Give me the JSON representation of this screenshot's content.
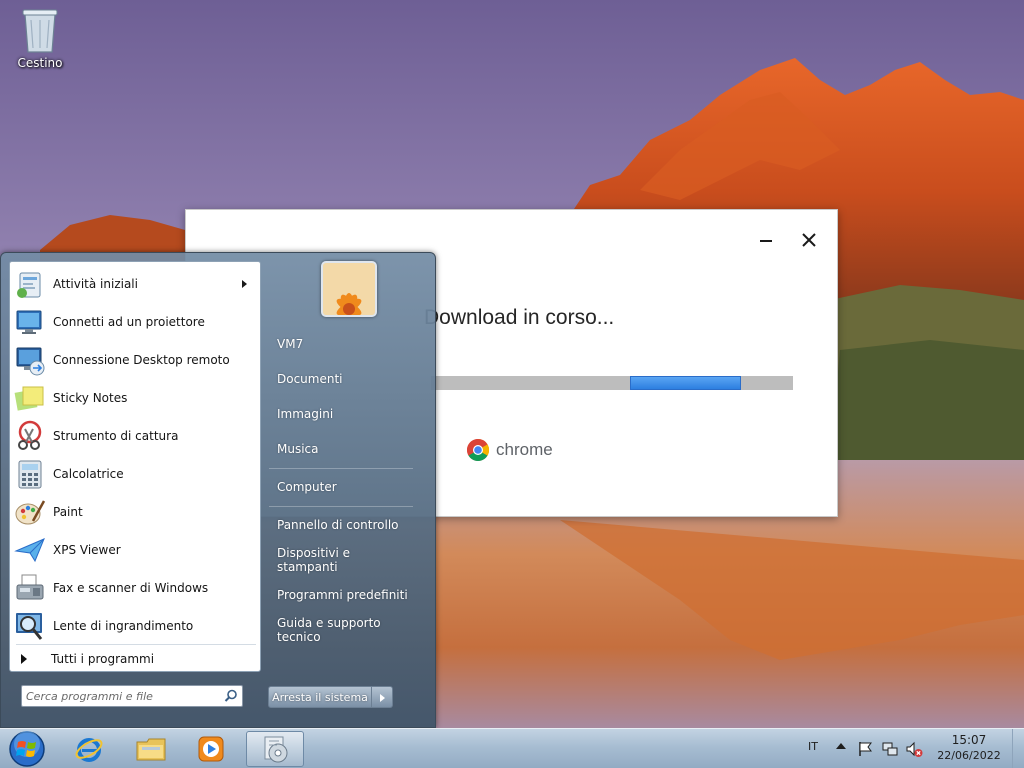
{
  "desktop": {
    "icons": [
      {
        "label": "Cestino",
        "icon": "recycle-bin-icon"
      }
    ]
  },
  "installer": {
    "title": "Download in corso...",
    "progress": 0.31,
    "brand": "chrome",
    "minimize_icon": "minimize-icon",
    "close_icon": "close-icon"
  },
  "start_menu": {
    "programs": [
      {
        "label": "Attività iniziali",
        "icon": "getting-started-icon",
        "has_submenu": true
      },
      {
        "label": "Connetti ad un proiettore",
        "icon": "projector-icon"
      },
      {
        "label": "Connessione Desktop remoto",
        "icon": "remote-desktop-icon"
      },
      {
        "label": "Sticky Notes",
        "icon": "sticky-notes-icon"
      },
      {
        "label": "Strumento di cattura",
        "icon": "snipping-tool-icon"
      },
      {
        "label": "Calcolatrice",
        "icon": "calculator-icon"
      },
      {
        "label": "Paint",
        "icon": "paint-icon"
      },
      {
        "label": "XPS Viewer",
        "icon": "xps-viewer-icon"
      },
      {
        "label": "Fax e scanner di Windows",
        "icon": "fax-scanner-icon"
      },
      {
        "label": "Lente di ingrandimento",
        "icon": "magnifier-icon"
      }
    ],
    "all_programs": "Tutti i programmi",
    "search_placeholder": "Cerca programmi e file",
    "places": [
      "VM7",
      "Documenti",
      "Immagini",
      "Musica",
      "Computer",
      "Pannello di controllo",
      "Dispositivi e stampanti",
      "Programmi predefiniti",
      "Guida e supporto tecnico"
    ],
    "shutdown_label": "Arresta il sistema"
  },
  "taskbar": {
    "pinned": [
      {
        "name": "internet-explorer",
        "icon": "internet-explorer-icon"
      },
      {
        "name": "explorer",
        "icon": "folder-icon"
      },
      {
        "name": "media-player",
        "icon": "media-player-icon"
      },
      {
        "name": "chrome-installer",
        "icon": "installer-icon",
        "active": true
      }
    ],
    "language": "IT",
    "tray_icons": [
      "action-center-flag-icon",
      "network-icon",
      "volume-muted-icon"
    ],
    "time": "15:07",
    "date": "22/06/2022"
  },
  "colors": {
    "progress_fill": "#2d7fe0",
    "progress_track": "#bdbdbd",
    "taskbar": "#a7bdd2"
  }
}
